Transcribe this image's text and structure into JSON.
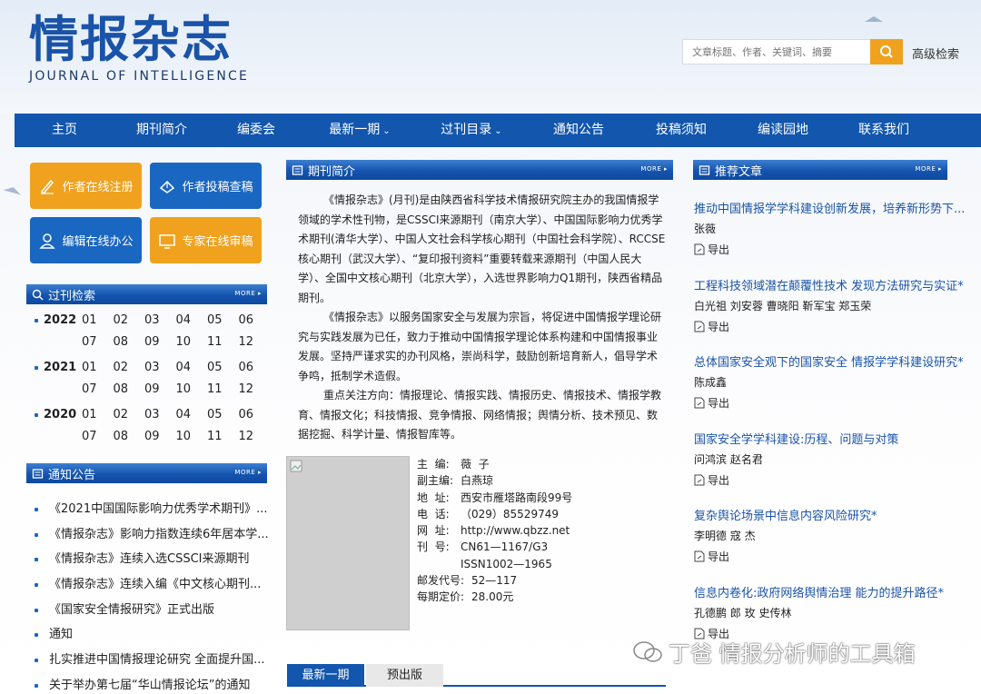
{
  "header": {
    "logo_cn": "情报杂志",
    "logo_en": "JOURNAL OF INTELLIGENCE",
    "search_placeholder": "文章标题、作者、关键词、摘要",
    "advanced_search": "高级检索"
  },
  "nav": [
    "主页",
    "期刊简介",
    "编委会",
    "最新一期",
    "过刊目录",
    "通知公告",
    "投稿须知",
    "编读园地",
    "联系我们"
  ],
  "quick": {
    "author_register": "作者在线注册",
    "author_submit": "作者投稿查稿",
    "editor_office": "编辑在线办公",
    "expert_review": "专家在线审稿"
  },
  "archive": {
    "title": "过刊检索",
    "more": "more",
    "years": [
      {
        "year": "2022",
        "months": [
          "01",
          "02",
          "03",
          "04",
          "05",
          "06",
          "07",
          "08",
          "09",
          "10",
          "11",
          "12"
        ]
      },
      {
        "year": "2021",
        "months": [
          "01",
          "02",
          "03",
          "04",
          "05",
          "06",
          "07",
          "08",
          "09",
          "10",
          "11",
          "12"
        ]
      },
      {
        "year": "2020",
        "months": [
          "01",
          "02",
          "03",
          "04",
          "05",
          "06",
          "07",
          "08",
          "09",
          "10",
          "11",
          "12"
        ]
      }
    ]
  },
  "notices": {
    "title": "通知公告",
    "more": "more",
    "items": [
      "《2021中国国际影响力优秀学术期刊》...",
      "《情报杂志》影响力指数连续6年居本学...",
      "《情报杂志》连续入选CSSCI来源期刊",
      "《情报杂志》连续入编《中文核心期刊...",
      "《国家安全情报研究》正式出版",
      "通知",
      "扎实推进中国情报理论研究 全面提升国...",
      "关于举办第七届“华山情报论坛”的通知"
    ]
  },
  "intro": {
    "title": "期刊简介",
    "more": "more",
    "p1": "《情报杂志》(月刊)是由陕西省科学技术情报研究院主办的我国情报学领域的学术性刊物，是CSSCI来源期刊（南京大学）、中国国际影响力优秀学术期刊(清华大学）、中国人文社会科学核心期刊（中国社会科学院）、RCCSE核心期刊（武汉大学）、“复印报刊资料”重要转载来源期刊（中国人民大学）、全国中文核心期刊（北京大学），入选世界影响力Q1期刊，陕西省精品期刊。",
    "p2": "《情报杂志》以服务国家安全与发展为宗旨，将促进中国情报学理论研究与实践发展为已任，致力于推动中国情报学理论体系构建和中国情报事业发展。坚持严谨求实的办刊风格，崇尚科学，鼓励创新培育新人，倡导学术争鸣，抵制学术造假。",
    "p3": "重点关注方向：情报理论、情报实践、情报历史、情报技术、情报学教育、情报文化；科技情报、竞争情报、网络情报；舆情分析、技术预见、数据挖掘、科学计量、情报智库等。"
  },
  "info": [
    {
      "k": "主  编:",
      "v": "薇  子"
    },
    {
      "k": "副主编:",
      "v": "白燕琼"
    },
    {
      "k": "地  址:",
      "v": "西安市雁塔路南段99号"
    },
    {
      "k": "电  话:",
      "v": "（029）85529749"
    },
    {
      "k": "网  址:",
      "v": "http://www.qbzz.net"
    },
    {
      "k": "刊  号:",
      "v": "CN61—1167/G3"
    },
    {
      "k": "",
      "v": "ISSN1002—1965"
    },
    {
      "k": "邮发代号:",
      "v": "52—117"
    },
    {
      "k": "每期定价:",
      "v": "28.00元"
    }
  ],
  "tabs": [
    "最新一期",
    "预出版"
  ],
  "recommend": {
    "title": "推荐文章",
    "more": "more",
    "export": "导出",
    "items": [
      {
        "title": "推动中国情报学学科建设创新发展，培养新形势下...",
        "authors": "张薇"
      },
      {
        "title": "工程科技领域潜在颠覆性技术 发现方法研究与实证*",
        "authors": "白光祖 刘安蓉 曹晓阳 靳军宝 郑玉荣"
      },
      {
        "title": "总体国家安全观下的国家安全 情报学学科建设研究*",
        "authors": "陈成鑫"
      },
      {
        "title": "国家安全学学科建设:历程、问题与对策",
        "authors": "问鸿滨 赵名君"
      },
      {
        "title": "复杂舆论场景中信息内容风险研究*",
        "authors": "李明德 寇 杰"
      },
      {
        "title": "信息内卷化:政府网络舆情治理 能力的提升路径*",
        "authors": "孔德鹏 郎 玫 史传林"
      }
    ]
  },
  "watermark": "丁爸 情报分析师的工具箱"
}
